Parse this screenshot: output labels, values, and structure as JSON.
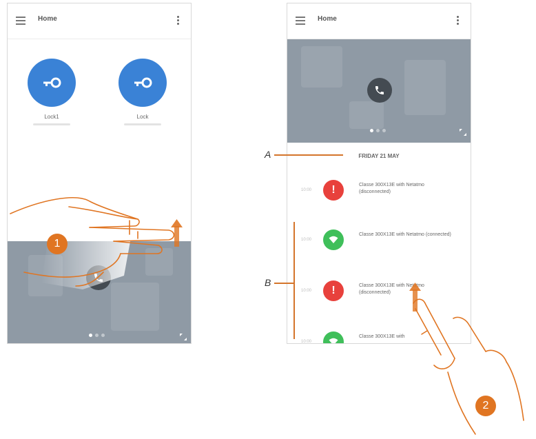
{
  "left_screen": {
    "header": {
      "title": "Home"
    },
    "locks": [
      {
        "label": "Lock1"
      },
      {
        "label": "Lock"
      }
    ]
  },
  "right_screen": {
    "header": {
      "title": "Home"
    },
    "date_heading": "FRIDAY 21 MAY",
    "events": [
      {
        "time": "10:00",
        "status": "alert",
        "text": "Classe 300X13E with Netatmo (disconnected)"
      },
      {
        "time": "10:00",
        "status": "ok",
        "text": "Classe 300X13E with Netatmo (connected)"
      },
      {
        "time": "10:00",
        "status": "alert",
        "text": "Classe 300X13E with Netatmo (disconnected)"
      },
      {
        "time": "10:00",
        "status": "ok",
        "text": "Classe 300X13E with"
      }
    ]
  },
  "callouts": {
    "a": "A",
    "b": "B"
  },
  "steps": {
    "one": "1",
    "two": "2"
  },
  "icons": {
    "menu": "hamburger-menu-icon",
    "more": "kebab-menu-icon",
    "lock": "key-icon",
    "call": "phone-handset-icon",
    "expand": "expand-icon",
    "alert": "exclamation-icon",
    "ok": "wifi-icon",
    "swipe": "swipe-up-arrow-icon",
    "hand": "hand-gesture-icon"
  },
  "colors": {
    "accent": "#e07522",
    "lock_blue": "#3a82d6",
    "alert_red": "#e8413c",
    "ok_green": "#3fbf5a",
    "camera_bg": "#8f9aa5"
  }
}
